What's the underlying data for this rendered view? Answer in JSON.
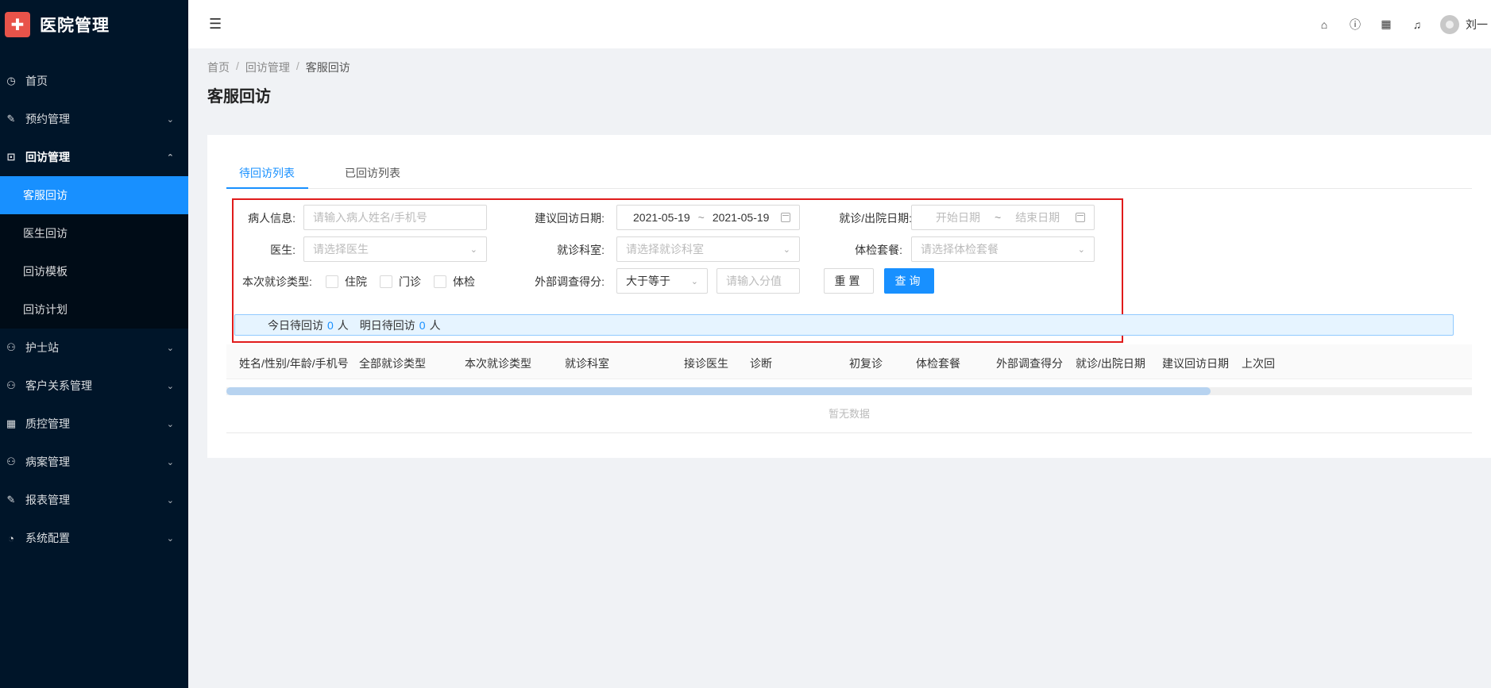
{
  "app": {
    "title": "医院管理",
    "logo_glyph": "✚"
  },
  "header": {
    "fold_icon": "menu-fold-icon",
    "icons": [
      "home-icon",
      "question-icon",
      "apps-icon",
      "bell-icon"
    ],
    "user_name": "刘一"
  },
  "sidebar": {
    "items": [
      {
        "label": "首页",
        "icon": "dashboard-icon"
      },
      {
        "label": "预约管理",
        "icon": "edit-icon"
      },
      {
        "label": "回访管理",
        "icon": "lock-icon",
        "open": true
      },
      {
        "label": "护士站",
        "icon": "user-icon"
      },
      {
        "label": "客户关系管理",
        "icon": "team-icon"
      },
      {
        "label": "质控管理",
        "icon": "table-icon"
      },
      {
        "label": "病案管理",
        "icon": "user-icon"
      },
      {
        "label": "报表管理",
        "icon": "edit-icon"
      },
      {
        "label": "系统配置",
        "icon": "gauge-icon"
      }
    ],
    "sub_items": [
      {
        "label": "客服回访",
        "active": true
      },
      {
        "label": "医生回访"
      },
      {
        "label": "回访模板"
      },
      {
        "label": "回访计划"
      }
    ]
  },
  "breadcrumb": {
    "items": [
      "首页",
      "回访管理",
      "客服回访"
    ],
    "separator": "/"
  },
  "page_title": "客服回访",
  "tabs": [
    {
      "label": "待回访列表",
      "active": true
    },
    {
      "label": "已回访列表"
    }
  ],
  "filters": {
    "patient_label": "病人信息:",
    "patient_placeholder": "请输入病人姓名/手机号",
    "suggest_date_label": "建议回访日期:",
    "suggest_date_start": "2021-05-19",
    "suggest_date_end": "2021-05-19",
    "visit_date_label": "就诊/出院日期:",
    "visit_date_start_placeholder": "开始日期",
    "visit_date_end_placeholder": "结束日期",
    "range_separator": "~",
    "doctor_label": "医生:",
    "doctor_placeholder": "请选择医生",
    "dept_label": "就诊科室:",
    "dept_placeholder": "请选择就诊科室",
    "package_label": "体检套餐:",
    "package_placeholder": "请选择体检套餐",
    "visit_type_label": "本次就诊类型:",
    "visit_types": [
      "住院",
      "门诊",
      "体检"
    ],
    "score_label": "外部调查得分:",
    "score_op": "大于等于",
    "score_placeholder": "请输入分值",
    "reset_label": "重置",
    "query_label": "查询"
  },
  "summary": {
    "today_label": "今日待回访",
    "today_count": "0",
    "tomorrow_label": "明日待回访",
    "tomorrow_count": "0",
    "unit": "人"
  },
  "table": {
    "columns": [
      "姓名/性别/年龄/手机号",
      "全部就诊类型",
      "本次就诊类型",
      "就诊科室",
      "接诊医生",
      "诊断",
      "初复诊",
      "体检套餐",
      "外部调查得分",
      "就诊/出院日期",
      "建议回访日期",
      "上次回"
    ],
    "empty_text": "暂无数据",
    "scroll_fraction": 0.79
  }
}
